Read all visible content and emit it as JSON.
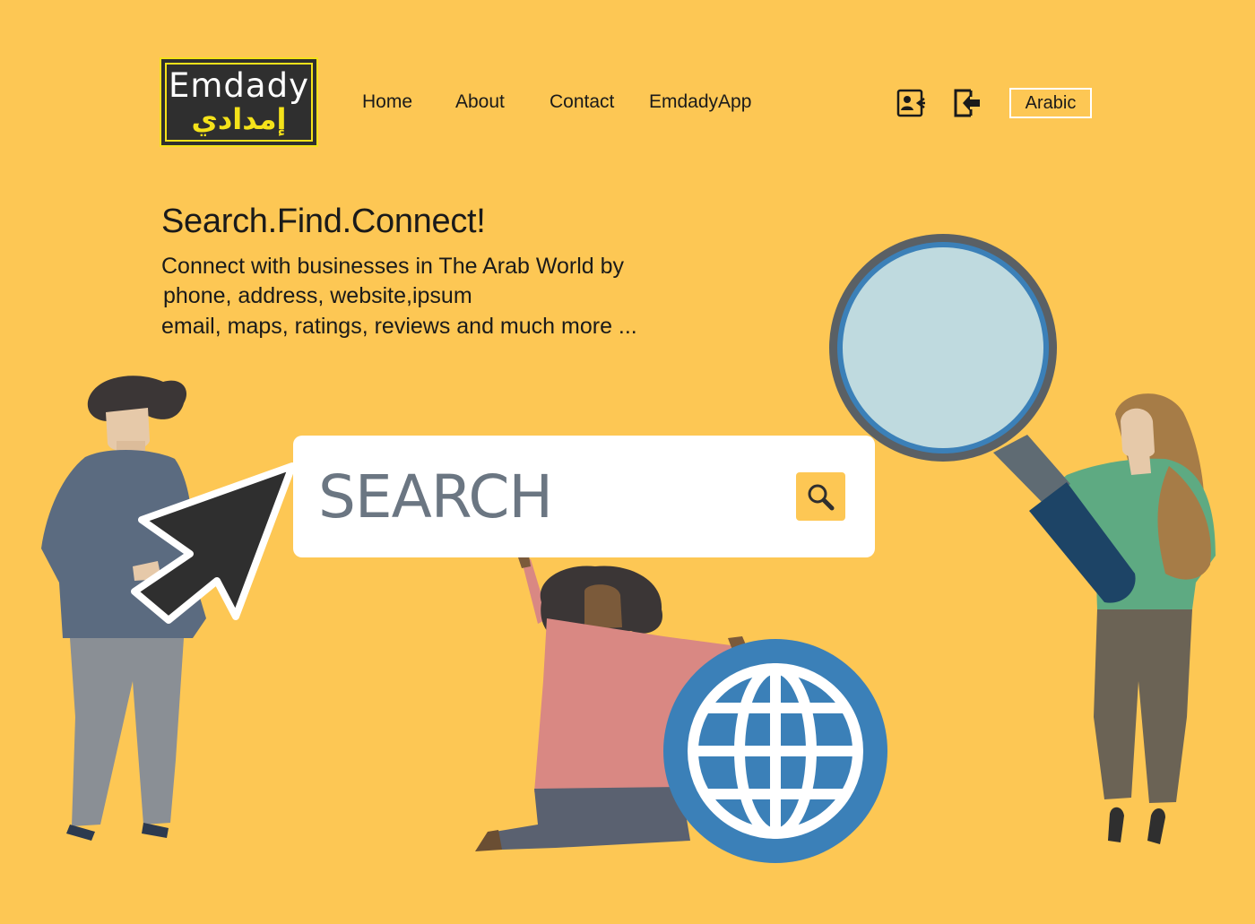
{
  "brand": {
    "name_latin": "Emdady",
    "name_arabic": "إمدادي"
  },
  "nav": [
    {
      "label": "Home"
    },
    {
      "label": "About"
    },
    {
      "label": "Contact"
    },
    {
      "label": "EmdadyApp"
    }
  ],
  "header_icons": [
    "contact-card-icon",
    "login-icon"
  ],
  "language_button": "Arabic",
  "hero": {
    "title": "Search.Find.Connect!",
    "lines": [
      "Connect with businesses in The Arab World by",
      "phone, address, website,ipsum",
      "email, maps, ratings, reviews and much more ..."
    ]
  },
  "search": {
    "placeholder": "SEARCH"
  },
  "colors": {
    "background": "#fdc754",
    "logo_background": "#2f2f2f",
    "logo_accent": "#f4e21a",
    "globe_blue": "#3b80b8"
  }
}
